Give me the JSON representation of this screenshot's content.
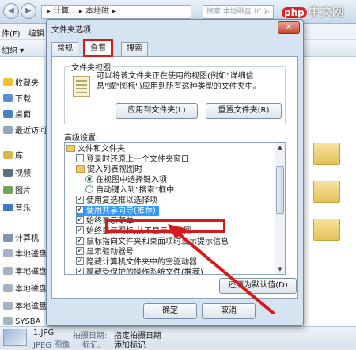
{
  "explorer": {
    "nav_back": "◀",
    "nav_forward": "▶",
    "address": "▸ 计算... ▸ 本地磁 ▸",
    "search_placeholder": "搜索 本地磁盘 (C:)",
    "menu": [
      "件(F)",
      "编辑"
    ],
    "toolbar": [
      "组织 ▾"
    ],
    "sidebar": [
      {
        "label": "收藏夹",
        "icon": "star-icon"
      },
      {
        "label": "下载",
        "icon": "download-folder-icon"
      },
      {
        "label": "桌面",
        "icon": "desktop-icon"
      },
      {
        "label": "最近访问",
        "icon": "recent-places-icon"
      },
      {
        "label": "库",
        "icon": "library-icon"
      },
      {
        "label": "视频",
        "icon": "video-library-icon"
      },
      {
        "label": "图片",
        "icon": "picture-library-icon"
      },
      {
        "label": "音乐",
        "icon": "music-library-icon"
      },
      {
        "label": "计算机",
        "icon": "computer-icon"
      },
      {
        "label": "本地磁盘",
        "icon": "drive-icon"
      },
      {
        "label": "本地磁盘",
        "icon": "drive-icon"
      },
      {
        "label": "本地磁盘",
        "icon": "drive-icon"
      },
      {
        "label": "本地磁盘",
        "icon": "drive-icon"
      },
      {
        "label": "SYSBA",
        "icon": "drive-icon"
      }
    ],
    "status": {
      "filename": "1.JPG",
      "date_label": "拍摄日期:",
      "date_value": "指定拍摄日期",
      "sub1": "JPEG 图像",
      "sub2_label": "标记:",
      "sub2_value": "添加标记"
    },
    "watermark_badge": "php",
    "watermark_text": "中文网"
  },
  "dialog": {
    "title": "文件夹选项",
    "close": "✕",
    "tabs": [
      "常规",
      "查看",
      "搜索"
    ],
    "active_tab": "查看",
    "folder_views": {
      "legend": "文件夹视图",
      "description": "可以将该文件夹正在使用的视图(例如\"详细信息\"或\"图标\")应用到所有这种类型的文件夹中。",
      "apply_button": "应用到文件夹(L)",
      "reset_button": "重置文件夹(R)"
    },
    "advanced_label": "高级设置:",
    "tree": [
      {
        "type": "folder",
        "label": "文件和文件夹",
        "indent": 0
      },
      {
        "type": "checkbox",
        "checked": false,
        "label": "登录时还原上一个文件夹窗口",
        "indent": 1
      },
      {
        "type": "folder",
        "label": "键入列表视图时",
        "indent": 1
      },
      {
        "type": "radio",
        "checked": true,
        "label": "在视图中选择键入项",
        "indent": 2
      },
      {
        "type": "radio",
        "checked": false,
        "label": "自动键入到\"搜索\"框中",
        "indent": 2
      },
      {
        "type": "checkbox",
        "checked": true,
        "label": "使用复选框以选择项",
        "indent": 1
      },
      {
        "type": "checkbox",
        "checked": true,
        "label": "使用共享向导(推荐)",
        "indent": 1,
        "highlight": true
      },
      {
        "type": "checkbox",
        "checked": true,
        "label": "始终显示菜单",
        "indent": 1
      },
      {
        "type": "checkbox",
        "checked": true,
        "label": "始终显示图标,从不显示缩略图",
        "indent": 1
      },
      {
        "type": "checkbox",
        "checked": true,
        "label": "鼠标指向文件夹和桌面项时显示提示信息",
        "indent": 1
      },
      {
        "type": "checkbox",
        "checked": true,
        "label": "显示驱动器号",
        "indent": 1
      },
      {
        "type": "checkbox",
        "checked": true,
        "label": "隐藏计算机文件夹中的空驱动器",
        "indent": 1
      },
      {
        "type": "checkbox",
        "checked": true,
        "label": "隐藏受保护的操作系统文件(推荐)",
        "indent": 1
      }
    ],
    "restore_defaults": "还原为默认值(D)",
    "ok": "确定",
    "cancel": "取消"
  },
  "colors": {
    "annotation_red": "#d41a1a",
    "selection_blue": "#3399ff"
  }
}
